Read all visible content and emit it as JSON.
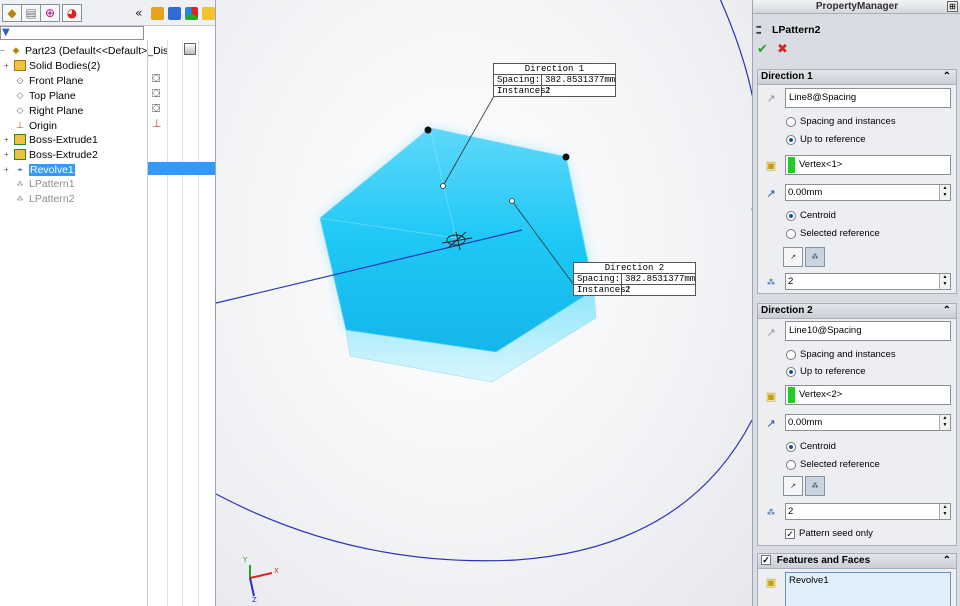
{
  "tree": {
    "filter_icon": "filter-icon",
    "root_label": "Part23  (Default<<Default>_Dis",
    "items": [
      {
        "label": "Solid Bodies(2)",
        "icon": "folder-icon"
      },
      {
        "label": "Front Plane",
        "icon": "plane-icon"
      },
      {
        "label": "Top Plane",
        "icon": "plane-icon"
      },
      {
        "label": "Right Plane",
        "icon": "plane-icon"
      },
      {
        "label": "Origin",
        "icon": "origin-icon"
      },
      {
        "label": "Boss-Extrude1",
        "icon": "extrude-icon"
      },
      {
        "label": "Boss-Extrude2",
        "icon": "extrude-icon"
      },
      {
        "label": "Revolve1",
        "icon": "revolve-icon"
      },
      {
        "label": "LPattern1",
        "icon": "pattern-icon"
      },
      {
        "label": "LPattern2",
        "icon": "pattern-icon"
      }
    ]
  },
  "callouts": {
    "dir1": {
      "title": "Direction 1",
      "spacing_label": "Spacing:",
      "spacing_value": "382.8531377mm",
      "instances_label": "Instances:",
      "instances_value": "2"
    },
    "dir2": {
      "title": "Direction 2",
      "spacing_label": "Spacing:",
      "spacing_value": "382.8531377mm",
      "instances_label": "Instances:",
      "instances_value": "2"
    }
  },
  "triad": {
    "x": "X",
    "y": "Y",
    "z": "Z"
  },
  "pm": {
    "header": "PropertyManager",
    "feature_name": "LPattern2",
    "dir1": {
      "title": "Direction 1",
      "direction_ref": "Line8@Spacing",
      "opt_spacing": "Spacing and instances",
      "opt_upto": "Up to reference",
      "reference": "Vertex<1>",
      "offset": "0.00mm",
      "opt_centroid": "Centroid",
      "opt_selected": "Selected reference",
      "instances": "2"
    },
    "dir2": {
      "title": "Direction 2",
      "direction_ref": "Line10@Spacing",
      "opt_spacing": "Spacing and instances",
      "opt_upto": "Up to reference",
      "reference": "Vertex<2>",
      "offset": "0.00mm",
      "opt_centroid": "Centroid",
      "opt_selected": "Selected reference",
      "instances": "2",
      "pattern_seed_only": "Pattern seed only"
    },
    "features": {
      "title": "Features and Faces",
      "items": [
        "Revolve1"
      ]
    }
  },
  "colors": {
    "accent": "#3399ff",
    "body": "#1ec8f5",
    "ok": "#2a9d2a",
    "cancel": "#dd2222",
    "reference": "#22cc22"
  }
}
